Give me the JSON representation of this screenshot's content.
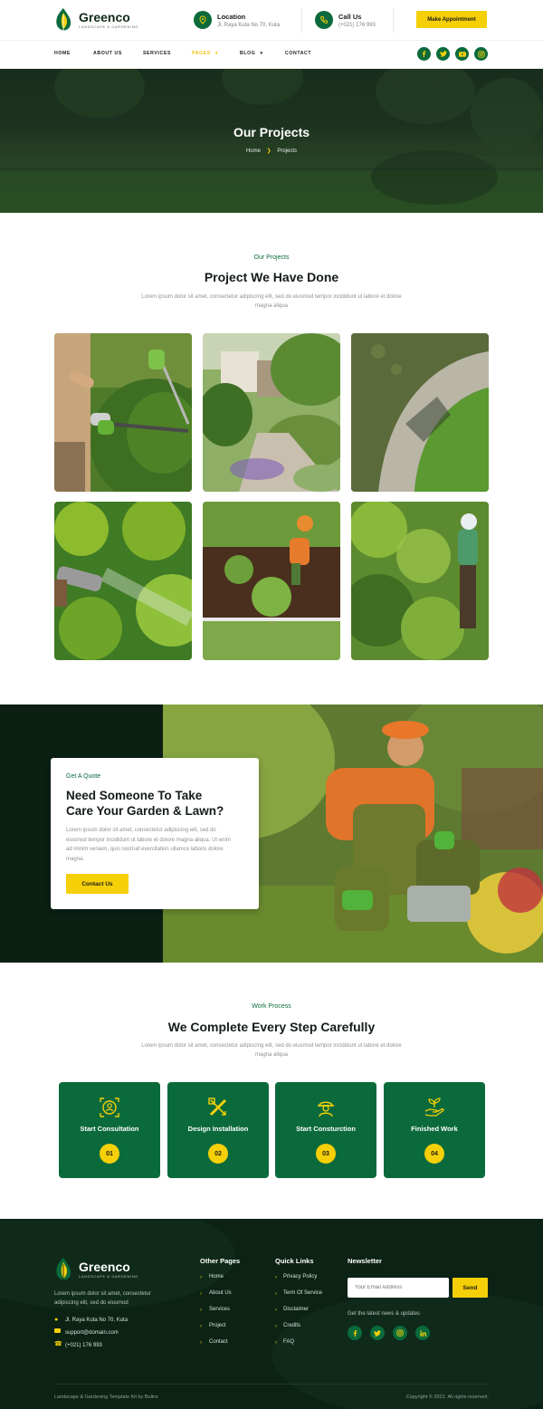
{
  "header": {
    "logo_name": "Greenco",
    "logo_tagline": "LANDSCAPE & GARDENING",
    "location_title": "Location",
    "location_value": "Jl. Raya Kuta No 70, Kuta",
    "call_title": "Call Us",
    "call_value": "(+021) 176 993",
    "cta_label": "Make Appointment",
    "nav": [
      {
        "label": "HOME"
      },
      {
        "label": "ABOUT US"
      },
      {
        "label": "SERVICES"
      },
      {
        "label": "PAGES",
        "active": true
      },
      {
        "label": "BLOG"
      },
      {
        "label": "CONTACT"
      }
    ],
    "social_icons": [
      "facebook-icon",
      "twitter-icon",
      "youtube-icon",
      "instagram-icon"
    ]
  },
  "hero": {
    "title": "Our Projects",
    "crumb_home": "Home",
    "crumb_current": "Projects"
  },
  "projects": {
    "kicker": "Our Projects",
    "title": "Project We Have Done",
    "lead": "Lorem ipsum dolor sit amet, consectetur adipiscing elit, sed do eiusmod tempor incididunt ut labore et dolore magna aliqua"
  },
  "quote": {
    "kicker": "Get A Quote",
    "title_line1": "Need Someone To Take",
    "title_line2": "Care Your Garden & Lawn?",
    "body": "Lorem ipsum dolor sit amet, consectetur adipiscing elit, sed do eiusmod tempor incididunt ut labore et dolore magna aliqua. Ut enim ad minim veniam, quis nostrud exercitation ullamco laboris dolore magna.",
    "button": "Contact Us"
  },
  "process": {
    "kicker": "Work Process",
    "title": "We Complete Every Step Carefully",
    "lead": "Lorem ipsum dolor sit amet, consectetur adipiscing elit, sed do eiusmod tempor incididunt ut labore et dolore magna aliqua",
    "steps": [
      {
        "title": "Start Consultation",
        "number": "01",
        "icon": "consultation-icon"
      },
      {
        "title": "Design Installation",
        "number": "02",
        "icon": "design-tools-icon"
      },
      {
        "title": "Start Consturction",
        "number": "03",
        "icon": "worker-icon"
      },
      {
        "title": "Finished Work",
        "number": "04",
        "icon": "plant-hand-icon"
      }
    ]
  },
  "footer": {
    "logo_name": "Greenco",
    "logo_tagline": "LANDSCAPE & GARDENING",
    "about_line1": "Lorem ipsum dolor sit amet, consectetur",
    "about_line2": "adipiscing elit, sed do eiusmod",
    "address": "Jl. Raya Kuta No 70, Kuta",
    "email": "support@domain.com",
    "phone": "(+021) 176 993",
    "other_pages_title": "Other Pages",
    "other_pages": [
      "Home",
      "About Us",
      "Services",
      "Project",
      "Contact"
    ],
    "quick_links_title": "Quick Links",
    "quick_links": [
      "Privacy Policy",
      "Term Of Service",
      "Disclaimer",
      "Credits",
      "FAQ"
    ],
    "newsletter_title": "Newsletter",
    "email_placeholder": "Your Email Address",
    "send_label": "Send",
    "newsletter_note": "Get the latest news & updates",
    "social_icons": [
      "facebook-icon",
      "twitter-icon",
      "instagram-icon",
      "linkedin-icon"
    ],
    "credit": "Landscape & Gardening Template Kit by Bulinz",
    "copyright": "Copyright © 2021. All rights reserved."
  },
  "colors": {
    "brand_green": "#0b6a3b",
    "accent_yellow": "#f5cf08",
    "dark_green": "#0b2214"
  }
}
